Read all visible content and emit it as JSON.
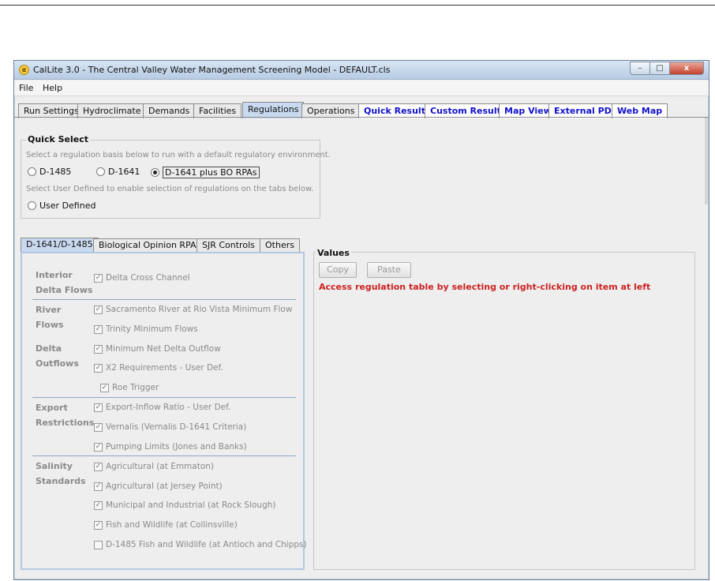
{
  "window": {
    "app_icon": "α",
    "title": "CalLite 3.0 -  The Central Valley Water Management Screening Model - DEFAULT.cls",
    "controls": {
      "minimize": "–",
      "maximize": "□",
      "close": "x"
    }
  },
  "menu": [
    {
      "label": "File",
      "underline": "F"
    },
    {
      "label": "Help",
      "underline": "H"
    }
  ],
  "tabs": [
    {
      "label": "Run Settings",
      "style": "normal"
    },
    {
      "label": "Hydroclimate",
      "style": "normal"
    },
    {
      "label": "Demands",
      "style": "normal"
    },
    {
      "label": "Facilities",
      "style": "normal"
    },
    {
      "label": "Regulations",
      "style": "active"
    },
    {
      "label": "Operations",
      "style": "normal"
    },
    {
      "label": "Quick Results",
      "style": "link"
    },
    {
      "label": "Custom Results",
      "style": "link"
    },
    {
      "label": "Map View",
      "style": "link"
    },
    {
      "label": "External PDF",
      "style": "link"
    },
    {
      "label": "Web Map",
      "style": "link"
    }
  ],
  "quick_select": {
    "title": "Quick Select",
    "hint1": "Select a regulation basis below to run with a default regulatory environment.",
    "options": [
      {
        "label": "D-1485",
        "selected": false
      },
      {
        "label": "D-1641",
        "selected": false
      },
      {
        "label": "D-1641 plus BO RPAs",
        "selected": true
      }
    ],
    "hint2": "Select User Defined to enable selection of regulations on the tabs below.",
    "user_defined": {
      "label": "User Defined",
      "selected": false
    }
  },
  "subtabs": [
    {
      "label": "D-1641/D-1485",
      "active": true
    },
    {
      "label": "Biological Opinion RPAs",
      "active": false
    },
    {
      "label": "SJR Controls",
      "active": false
    },
    {
      "label": "Others",
      "active": false
    }
  ],
  "regulations": {
    "categories": [
      {
        "label": "Interior\nDelta Flows"
      },
      {
        "label": "River\nFlows"
      },
      {
        "label": "Delta\nOutflows"
      },
      {
        "label": "Export\nRestrictions"
      },
      {
        "label": "Salinity\nStandards"
      }
    ],
    "items": [
      {
        "label": "Delta Cross Channel",
        "checked": true
      },
      {
        "label": "Sacramento River at Rio Vista Minimum Flow",
        "checked": true
      },
      {
        "label": "Trinity Minimum Flows",
        "checked": true
      },
      {
        "label": "Minimum Net Delta Outflow",
        "checked": true
      },
      {
        "label": "X2 Requirements - User Def.",
        "checked": true
      },
      {
        "label": "Roe Trigger",
        "checked": true
      },
      {
        "label": "Export-Inflow Ratio - User Def.",
        "checked": true
      },
      {
        "label": "Vernalis (Vernalis D-1641 Criteria)",
        "checked": true
      },
      {
        "label": "Pumping Limits (Jones and Banks)",
        "checked": true
      },
      {
        "label": "Agricultural (at Emmaton)",
        "checked": true
      },
      {
        "label": "Agricultural (at Jersey Point)",
        "checked": true
      },
      {
        "label": "Municipal and Industrial (at Rock Slough)",
        "checked": true
      },
      {
        "label": " Fish and Wildlife (at Collinsville)",
        "checked": true
      },
      {
        "label": "D-1485 Fish and Wildlife (at Antioch and Chipps)",
        "checked": false
      }
    ]
  },
  "values": {
    "title": "Values",
    "copy_label": "Copy",
    "paste_label": "Paste",
    "message": "Access regulation table by selecting or right-clicking on item at left"
  },
  "colors": {
    "active_tab": "#c9daf0",
    "link_tab": "#1111cc",
    "message": "#cc2222",
    "disabled_text": "#8a8a8a"
  }
}
